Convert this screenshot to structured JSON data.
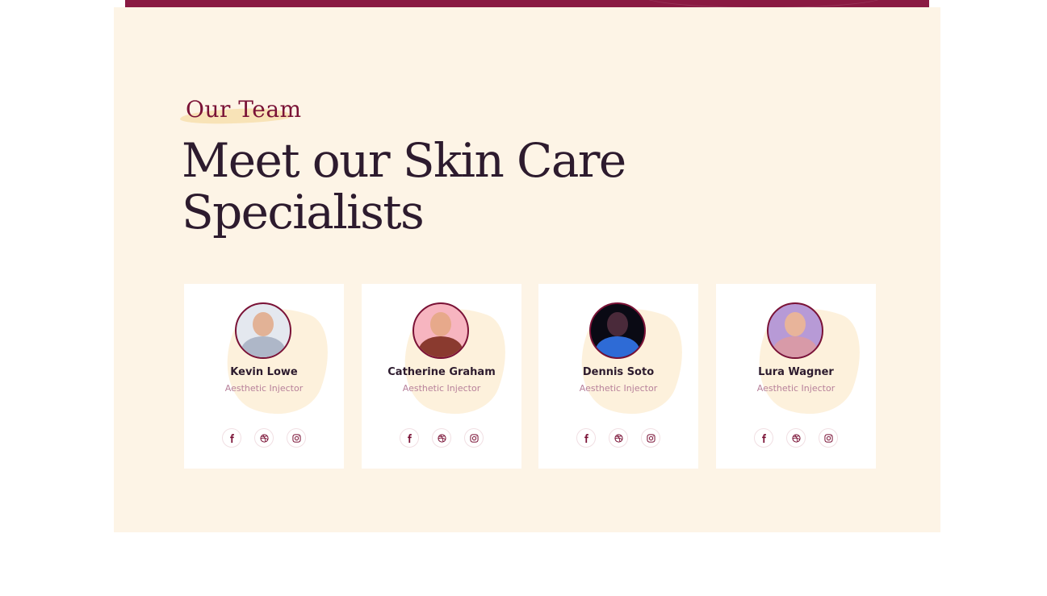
{
  "section": {
    "eyebrow": "Our Team",
    "heading": "Meet our Skin Care Specialists"
  },
  "team": [
    {
      "name": "Kevin Lowe",
      "role": "Aesthetic Injector",
      "avatar": {
        "bg": "#e4e8ef",
        "skin": "#e2b296",
        "shirt": "#aeb7c8"
      }
    },
    {
      "name": "Catherine Graham",
      "role": "Aesthetic Injector",
      "avatar": {
        "bg": "#f7b5c0",
        "skin": "#e7a98b",
        "shirt": "#8a3a2f"
      }
    },
    {
      "name": "Dennis Soto",
      "role": "Aesthetic Injector",
      "avatar": {
        "bg": "#0a0a14",
        "skin": "#4a2a3a",
        "shirt": "#2e6bd6"
      }
    },
    {
      "name": "Lura Wagner",
      "role": "Aesthetic Injector",
      "avatar": {
        "bg": "#b79ad6",
        "skin": "#e8b49a",
        "shirt": "#d89aa8"
      }
    }
  ],
  "social_icons": [
    "facebook-icon",
    "dribbble-icon",
    "instagram-icon"
  ],
  "colors": {
    "brand": "#7a1236",
    "heading": "#2d1b2e",
    "section_bg": "#fdf4e6",
    "role_text": "#b7809a"
  }
}
